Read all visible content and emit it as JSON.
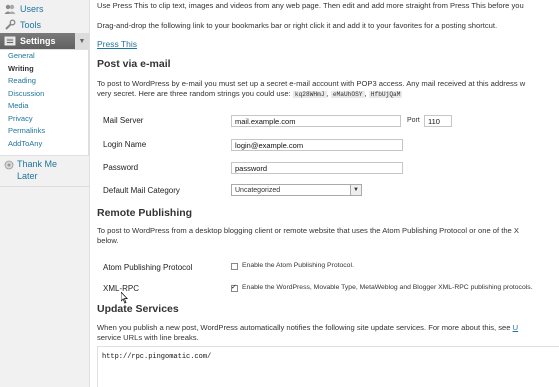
{
  "sidebar": {
    "users_label": "Users",
    "tools_label": "Tools",
    "settings_label": "Settings",
    "submenu": [
      "General",
      "Writing",
      "Reading",
      "Discussion",
      "Media",
      "Privacy",
      "Permalinks",
      "AddToAny"
    ],
    "current": "Writing",
    "thank_line1": "Thank Me",
    "thank_line2": "Later"
  },
  "press_this": {
    "line1": "Use Press This to clip text, images and videos from any web page. Then edit and add more straight from Press This before you",
    "line2": "Drag-and-drop the following link to your bookmarks bar or right click it and add it to your favorites for a posting shortcut.",
    "link": "Press This"
  },
  "post_via_email": {
    "heading": "Post via e-mail",
    "desc1": "To post to WordPress by e-mail you must set up a secret e-mail account with POP3 access. Any mail received at this address w",
    "desc2_prefix": "very secret. Here are three random strings you could use:",
    "codes": [
      "kq28WHmJ",
      "eMaUhOSY",
      "HfbUjQaM"
    ],
    "mail_server_label": "Mail Server",
    "mail_server_value": "mail.example.com",
    "port_label": "Port",
    "port_value": "110",
    "login_label": "Login Name",
    "login_value": "login@example.com",
    "password_label": "Password",
    "password_value": "password",
    "category_label": "Default Mail Category",
    "category_value": "Uncategorized"
  },
  "remote_publishing": {
    "heading": "Remote Publishing",
    "desc1": "To post to WordPress from a desktop blogging client or remote website that uses the Atom Publishing Protocol or one of the X",
    "desc2": "below.",
    "atom_label": "Atom Publishing Protocol",
    "atom_check": "Enable the Atom Publishing Protocol.",
    "atom_checked": false,
    "xmlrpc_label": "XML-RPC",
    "xmlrpc_check": "Enable the WordPress, Movable Type, MetaWeblog and Blogger XML-RPC publishing protocols.",
    "xmlrpc_checked": true
  },
  "update_services": {
    "heading": "Update Services",
    "desc1": "When you publish a new post, WordPress automatically notifies the following site update services. For more about this, see",
    "desc1_link": "U",
    "desc2": "service URLs with line breaks.",
    "ping_url": "http://rpc.pingomatic.com/"
  },
  "colors": {
    "link": "#21759b",
    "settings_head": "#6d6d6d"
  }
}
